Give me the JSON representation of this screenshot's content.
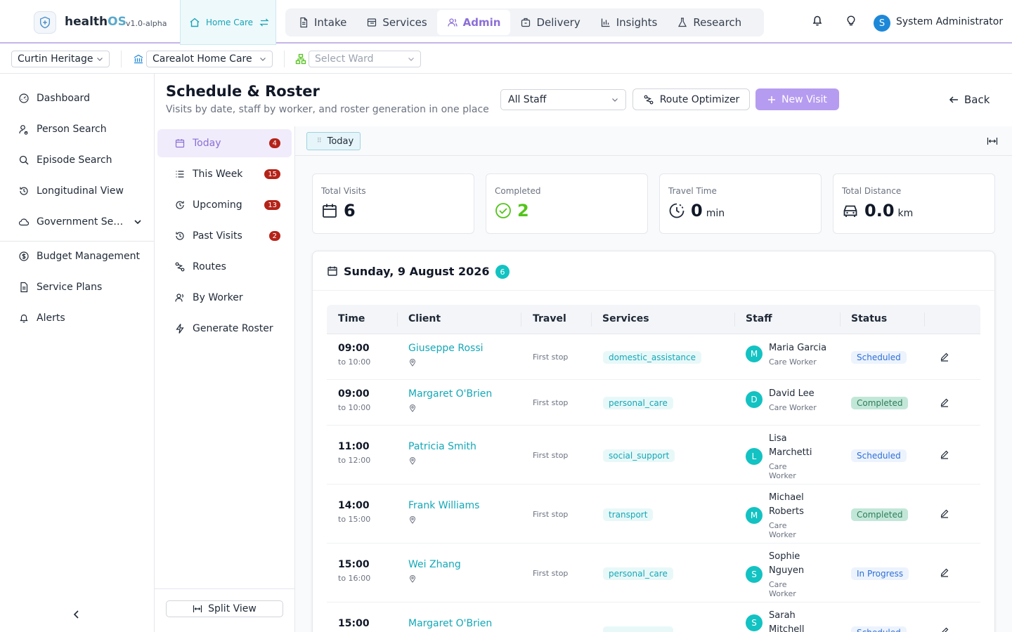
{
  "app": {
    "brand_main": "health",
    "brand_accent": "OS",
    "version": "v1.0-alpha",
    "module_label": "Home Care"
  },
  "nav": [
    {
      "label": "Intake",
      "icon": "document-icon"
    },
    {
      "label": "Services",
      "icon": "services-icon"
    },
    {
      "label": "Admin",
      "icon": "users-icon",
      "active": true
    },
    {
      "label": "Delivery",
      "icon": "briefcase-icon"
    },
    {
      "label": "Insights",
      "icon": "bar-chart-icon"
    },
    {
      "label": "Research",
      "icon": "flask-icon"
    }
  ],
  "user": {
    "initial": "S",
    "name": "System Administrator"
  },
  "context": {
    "organization": "Curtin Heritage",
    "facility": "Carealot Home Care",
    "ward_placeholder": "Select Ward"
  },
  "sidebar": [
    {
      "label": "Dashboard"
    },
    {
      "label": "Person Search"
    },
    {
      "label": "Episode Search"
    },
    {
      "label": "Longitudinal View"
    },
    {
      "label": "Government Services"
    },
    {
      "label": "Budget Management"
    },
    {
      "label": "Service Plans"
    },
    {
      "label": "Alerts"
    }
  ],
  "header": {
    "title": "Schedule & Roster",
    "subtitle": "Visits by date, staff by worker, and roster generation in one place",
    "staff_filter": "All Staff",
    "route_optimizer": "Route Optimizer",
    "new_visit": "New Visit",
    "back": "Back"
  },
  "subnav": [
    {
      "label": "Today",
      "badge": "4",
      "active": true
    },
    {
      "label": "This Week",
      "badge": "15"
    },
    {
      "label": "Upcoming",
      "badge": "13"
    },
    {
      "label": "Past Visits",
      "badge": "2"
    },
    {
      "label": "Routes"
    },
    {
      "label": "By Worker"
    },
    {
      "label": "Generate Roster"
    }
  ],
  "split_view": "Split View",
  "tab": {
    "label": "Today"
  },
  "stats": [
    {
      "label": "Total Visits",
      "value": "6",
      "unit": ""
    },
    {
      "label": "Completed",
      "value": "2",
      "unit": ""
    },
    {
      "label": "Travel Time",
      "value": "0",
      "unit": "min"
    },
    {
      "label": "Total Distance",
      "value": "0.0",
      "unit": "km"
    }
  ],
  "day": {
    "title": "Sunday, 9 August 2026",
    "count": "6"
  },
  "table": {
    "columns": [
      "Time",
      "Client",
      "Travel",
      "Services",
      "Staff",
      "Status"
    ],
    "rows": [
      {
        "start": "09:00",
        "end": "to 10:00",
        "client": "Giuseppe Rossi",
        "travel": "First stop",
        "service": "domestic_assistance",
        "staff_initial": "M",
        "staff": "Maria Garcia",
        "role": "Care Worker",
        "status": "Scheduled",
        "status_type": "scheduled"
      },
      {
        "start": "09:00",
        "end": "to 10:00",
        "client": "Margaret O'Brien",
        "travel": "First stop",
        "service": "personal_care",
        "staff_initial": "D",
        "staff": "David Lee",
        "role": "Care Worker",
        "status": "Completed",
        "status_type": "completed"
      },
      {
        "start": "11:00",
        "end": "to 12:00",
        "client": "Patricia Smith",
        "travel": "First stop",
        "service": "social_support",
        "staff_initial": "L",
        "staff": "Lisa Marchetti",
        "role": "Care Worker",
        "status": "Scheduled",
        "status_type": "scheduled"
      },
      {
        "start": "14:00",
        "end": "to 15:00",
        "client": "Frank Williams",
        "travel": "First stop",
        "service": "transport",
        "staff_initial": "M",
        "staff": "Michael Roberts",
        "role": "Care Worker",
        "status": "Completed",
        "status_type": "completed"
      },
      {
        "start": "15:00",
        "end": "to 16:00",
        "client": "Wei Zhang",
        "travel": "First stop",
        "service": "personal_care",
        "staff_initial": "S",
        "staff": "Sophie Nguyen",
        "role": "Care Worker",
        "status": "In Progress",
        "status_type": "inprogress"
      },
      {
        "start": "15:00",
        "end": "",
        "client": "Margaret O'Brien",
        "travel": "",
        "service": "",
        "staff_initial": "S",
        "staff": "Sarah Mitchell",
        "role": "",
        "status": "Scheduled",
        "status_type": "scheduled"
      }
    ]
  }
}
